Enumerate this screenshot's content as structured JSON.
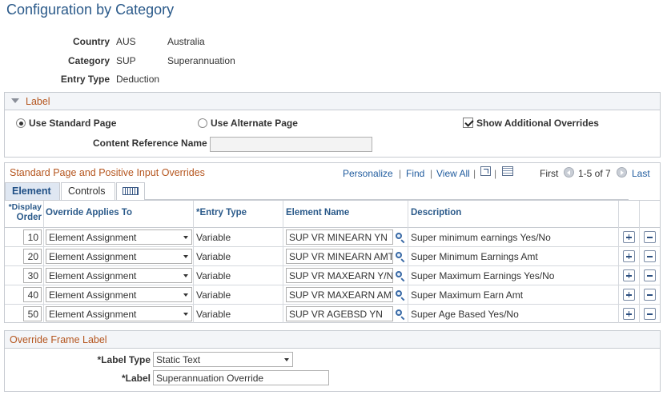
{
  "page": {
    "title": "Configuration by Category"
  },
  "info": [
    {
      "label": "Country",
      "code": "AUS",
      "desc": "Australia"
    },
    {
      "label": "Category",
      "code": "SUP",
      "desc": "Superannuation"
    },
    {
      "label": "Entry Type",
      "code": "Deduction",
      "desc": ""
    }
  ],
  "label_section": {
    "title": "Label",
    "use_standard_page": "Use Standard Page",
    "use_alternate_page": "Use Alternate Page",
    "show_additional_overrides": "Show Additional Overrides",
    "content_reference_name_label": "Content Reference Name",
    "content_reference_name_value": "",
    "standard_selected": true,
    "show_additional_checked": true
  },
  "grid": {
    "title": "Standard Page and Positive Input Overrides",
    "toolbar": {
      "personalize": "Personalize",
      "find": "Find",
      "view_all": "View All",
      "first": "First",
      "range": "1-5 of 7",
      "last": "Last",
      "sep": "|"
    },
    "tabs": {
      "element": "Element",
      "controls": "Controls"
    },
    "columns": {
      "display_order_1": "*Display",
      "display_order_2": "Order",
      "override_applies_to": "Override Applies To",
      "entry_type": "*Entry Type",
      "element_name": "Element Name",
      "description": "Description"
    },
    "rows": [
      {
        "order": "10",
        "applies": "Element Assignment",
        "entry": "Variable",
        "element": "SUP VR MINEARN YN",
        "desc": "Super minimum earnings Yes/No"
      },
      {
        "order": "20",
        "applies": "Element Assignment",
        "entry": "Variable",
        "element": "SUP VR MINEARN AMT",
        "desc": "Super Minimum Earnings Amt"
      },
      {
        "order": "30",
        "applies": "Element Assignment",
        "entry": "Variable",
        "element": "SUP VR MAXEARN Y/N",
        "desc": "Super Maximum Earnings Yes/No"
      },
      {
        "order": "40",
        "applies": "Element Assignment",
        "entry": "Variable",
        "element": "SUP VR MAXEARN AMT",
        "desc": "Super Maximum Earn Amt"
      },
      {
        "order": "50",
        "applies": "Element Assignment",
        "entry": "Variable",
        "element": "SUP VR AGEBSD YN",
        "desc": "Super Age Based Yes/No"
      }
    ]
  },
  "override_frame": {
    "title": "Override Frame Label",
    "label_type_label": "*Label Type",
    "label_type_value": "Static Text",
    "label_label": "*Label",
    "label_value": "Superannuation Override"
  }
}
